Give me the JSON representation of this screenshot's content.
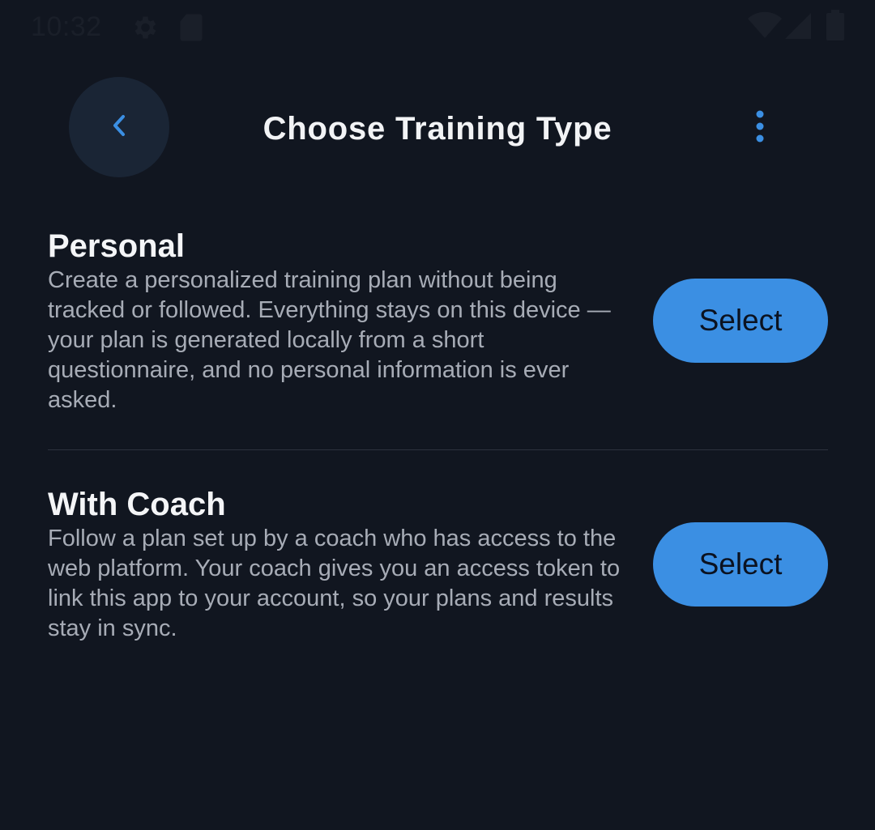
{
  "status_bar": {
    "time": "10:32",
    "icons": [
      "settings-icon",
      "sd-card-icon",
      "wifi-icon",
      "signal-icon",
      "battery-icon"
    ]
  },
  "header": {
    "title": "Choose Training Type",
    "back_icon": "chevron-left-icon",
    "menu_icon": "more-vertical-icon"
  },
  "options": [
    {
      "title": "Personal",
      "description": "Create a personalized training plan without being tracked or followed. Everything stays on this device — your plan is generated locally from a short questionnaire, and no personal information is ever asked.",
      "button_label": "Select"
    },
    {
      "title": "With Coach",
      "description": "Follow a plan set up by a coach who has access to the web platform. Your coach gives you an access token to link this app to your account, so your plans and results stay in sync.",
      "button_label": "Select"
    }
  ],
  "colors": {
    "background": "#111620",
    "accent": "#3b8fe3",
    "back_button_bg": "#1a2535",
    "title_text": "#f2f3f5",
    "description_text": "#a7acb6"
  }
}
